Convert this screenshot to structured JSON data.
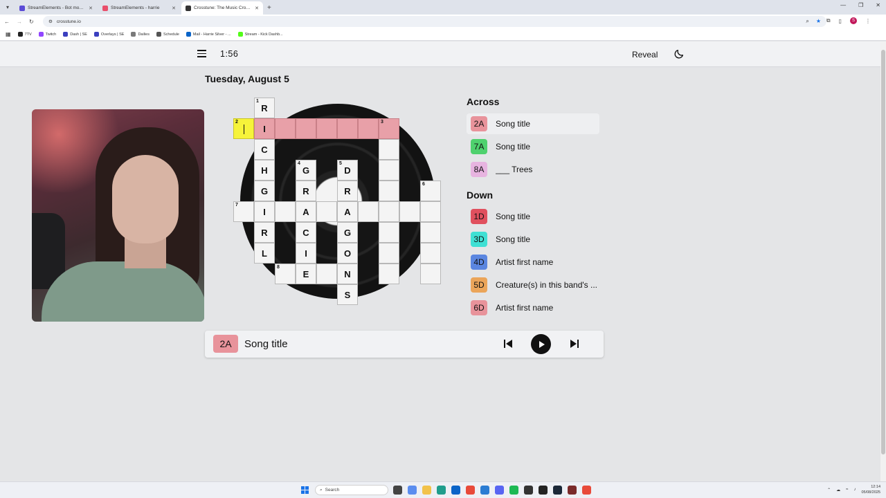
{
  "browser": {
    "tabs": [
      {
        "label": "StreamElements - Bot modules",
        "active": false,
        "color": "#5b4bd6"
      },
      {
        "label": "StreamElements - harrie",
        "active": false,
        "color": "#e94f6b"
      },
      {
        "label": "Crosstune: The Music Crosswo",
        "active": true,
        "color": "#333333"
      }
    ],
    "new_tab": "+",
    "url": "crosstune.io",
    "profile_initial": "S",
    "bookmarks": [
      {
        "label": "7TV",
        "color": "#222222"
      },
      {
        "label": "Twitch",
        "color": "#9146ff"
      },
      {
        "label": "Dash | SE",
        "color": "#3b3fbf"
      },
      {
        "label": "Overlays | SE",
        "color": "#3b3fbf"
      },
      {
        "label": "Dailies",
        "color": "#7a7a7a"
      },
      {
        "label": "Schedule",
        "color": "#555555"
      },
      {
        "label": "Mail - Harrie Silver - ...",
        "color": "#0a64c8"
      },
      {
        "label": "Stream - Kick Dashb...",
        "color": "#53fc18"
      }
    ]
  },
  "app": {
    "timer": "1:56",
    "reveal_label": "Reveal",
    "date": "Tuesday, August 5"
  },
  "board": {
    "cells": [
      {
        "r": 0,
        "c": 1,
        "num": "1",
        "letter": "R"
      },
      {
        "r": 1,
        "c": 0,
        "num": "2",
        "letter": "",
        "state": "cur"
      },
      {
        "r": 1,
        "c": 1,
        "letter": "I",
        "state": "hl"
      },
      {
        "r": 1,
        "c": 2,
        "letter": "",
        "state": "hl"
      },
      {
        "r": 1,
        "c": 3,
        "letter": "",
        "state": "hl"
      },
      {
        "r": 1,
        "c": 4,
        "letter": "",
        "state": "hl"
      },
      {
        "r": 1,
        "c": 5,
        "letter": "",
        "state": "hl"
      },
      {
        "r": 1,
        "c": 6,
        "letter": "",
        "state": "hl"
      },
      {
        "r": 1,
        "c": 7,
        "num": "3",
        "letter": "",
        "state": "hl"
      },
      {
        "r": 2,
        "c": 1,
        "letter": "C"
      },
      {
        "r": 2,
        "c": 7,
        "letter": ""
      },
      {
        "r": 3,
        "c": 1,
        "letter": "H"
      },
      {
        "r": 3,
        "c": 3,
        "num": "4",
        "letter": "G"
      },
      {
        "r": 3,
        "c": 5,
        "num": "5",
        "letter": "D"
      },
      {
        "r": 3,
        "c": 7,
        "letter": ""
      },
      {
        "r": 4,
        "c": 1,
        "letter": "G"
      },
      {
        "r": 4,
        "c": 3,
        "letter": "R"
      },
      {
        "r": 4,
        "c": 5,
        "letter": "R"
      },
      {
        "r": 4,
        "c": 7,
        "letter": ""
      },
      {
        "r": 4,
        "c": 9,
        "num": "6",
        "letter": ""
      },
      {
        "r": 5,
        "c": 0,
        "num": "7",
        "letter": ""
      },
      {
        "r": 5,
        "c": 1,
        "letter": "I"
      },
      {
        "r": 5,
        "c": 2,
        "letter": ""
      },
      {
        "r": 5,
        "c": 3,
        "letter": "A"
      },
      {
        "r": 5,
        "c": 4,
        "letter": ""
      },
      {
        "r": 5,
        "c": 5,
        "letter": "A"
      },
      {
        "r": 5,
        "c": 6,
        "letter": ""
      },
      {
        "r": 5,
        "c": 7,
        "letter": ""
      },
      {
        "r": 5,
        "c": 8,
        "letter": ""
      },
      {
        "r": 5,
        "c": 9,
        "letter": ""
      },
      {
        "r": 6,
        "c": 1,
        "letter": "R"
      },
      {
        "r": 6,
        "c": 3,
        "letter": "C"
      },
      {
        "r": 6,
        "c": 5,
        "letter": "G"
      },
      {
        "r": 6,
        "c": 7,
        "letter": ""
      },
      {
        "r": 6,
        "c": 9,
        "letter": ""
      },
      {
        "r": 7,
        "c": 1,
        "letter": "L"
      },
      {
        "r": 7,
        "c": 3,
        "letter": "I"
      },
      {
        "r": 7,
        "c": 5,
        "letter": "O"
      },
      {
        "r": 7,
        "c": 7,
        "letter": ""
      },
      {
        "r": 7,
        "c": 9,
        "letter": ""
      },
      {
        "r": 8,
        "c": 2,
        "num": "8",
        "letter": ""
      },
      {
        "r": 8,
        "c": 3,
        "letter": "E"
      },
      {
        "r": 8,
        "c": 4,
        "letter": ""
      },
      {
        "r": 8,
        "c": 5,
        "letter": "N"
      },
      {
        "r": 8,
        "c": 7,
        "letter": ""
      },
      {
        "r": 8,
        "c": 9,
        "letter": ""
      },
      {
        "r": 9,
        "c": 5,
        "letter": "S"
      }
    ]
  },
  "clues": {
    "across_heading": "Across",
    "down_heading": "Down",
    "across": [
      {
        "id": "2A",
        "text": "Song title",
        "color": "#e8939b",
        "active": true
      },
      {
        "id": "7A",
        "text": "Song title",
        "color": "#4fd16e"
      },
      {
        "id": "8A",
        "text": "___ Trees",
        "color": "#e7b4e0"
      }
    ],
    "down": [
      {
        "id": "1D",
        "text": "Song title",
        "color": "#e0505e"
      },
      {
        "id": "3D",
        "text": "Song title",
        "color": "#3fe0d4"
      },
      {
        "id": "4D",
        "text": "Artist first name",
        "color": "#5b86e0"
      },
      {
        "id": "5D",
        "text": "Creature(s) in this band's ...",
        "color": "#eba55a"
      },
      {
        "id": "6D",
        "text": "Artist first name",
        "color": "#e8939b"
      }
    ]
  },
  "player": {
    "clue_id": "2A",
    "clue_text": "Song title",
    "color": "#e8939b"
  },
  "taskbar": {
    "search_placeholder": "Search",
    "time": "12:14",
    "date": "05/08/2025"
  }
}
